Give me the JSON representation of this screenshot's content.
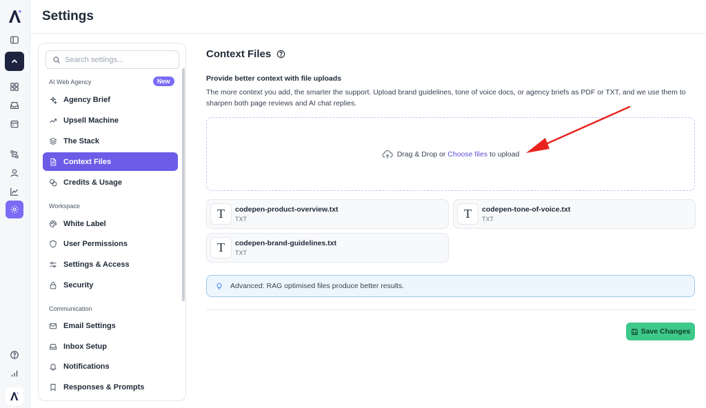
{
  "header": {
    "title": "Settings"
  },
  "rail": {
    "icons": [
      "logo-icon",
      "panel-icon",
      "chevron-up-icon",
      "grid-icon",
      "inbox-icon",
      "calendar-icon",
      "route-icon",
      "user-icon",
      "chart-icon",
      "gear-icon",
      "help-icon",
      "bar-chart-icon",
      "logo-icon"
    ]
  },
  "sidebar": {
    "search_placeholder": "Search settings...",
    "sections": [
      {
        "label": "AI Web Agency",
        "badge": "New"
      },
      {
        "label": "Workspace"
      },
      {
        "label": "Communication"
      }
    ],
    "items": [
      {
        "label": "Agency Brief",
        "icon": "sparkles-icon"
      },
      {
        "label": "Upsell Machine",
        "icon": "trending-up-icon"
      },
      {
        "label": "The Stack",
        "icon": "layers-icon"
      },
      {
        "label": "Context Files",
        "icon": "file-text-icon",
        "active": true
      },
      {
        "label": "Credits & Usage",
        "icon": "coins-icon"
      },
      {
        "label": "White Label",
        "icon": "palette-icon"
      },
      {
        "label": "User Permissions",
        "icon": "shield-icon"
      },
      {
        "label": "Settings & Access",
        "icon": "sliders-icon"
      },
      {
        "label": "Security",
        "icon": "lock-icon"
      },
      {
        "label": "Email Settings",
        "icon": "mail-icon"
      },
      {
        "label": "Inbox Setup",
        "icon": "inbox-icon"
      },
      {
        "label": "Notifications",
        "icon": "bell-icon"
      },
      {
        "label": "Responses & Prompts",
        "icon": "bookmark-icon"
      }
    ]
  },
  "main": {
    "title": "Context Files",
    "subtitle": "Provide better context with file uploads",
    "description": "The more context you add, the smarter the support. Upload brand guidelines, tone of voice docs, or agency briefs as PDF or TXT, and we use them to sharpen both page reviews and AI chat replies.",
    "dropzone": {
      "before": "Drag & Drop or",
      "link": "Choose files",
      "after": "to upload"
    },
    "files": [
      {
        "name": "codepen-product-overview.txt",
        "type": "TXT"
      },
      {
        "name": "codepen-tone-of-voice.txt",
        "type": "TXT"
      },
      {
        "name": "codepen-brand-guidelines.txt",
        "type": "TXT"
      }
    ],
    "info": "Advanced: RAG optimised files produce better results.",
    "save_label": "Save Changes"
  },
  "colors": {
    "accent": "#6c5ce7",
    "save": "#3ec98a",
    "annotation_arrow": "#e8231e"
  }
}
